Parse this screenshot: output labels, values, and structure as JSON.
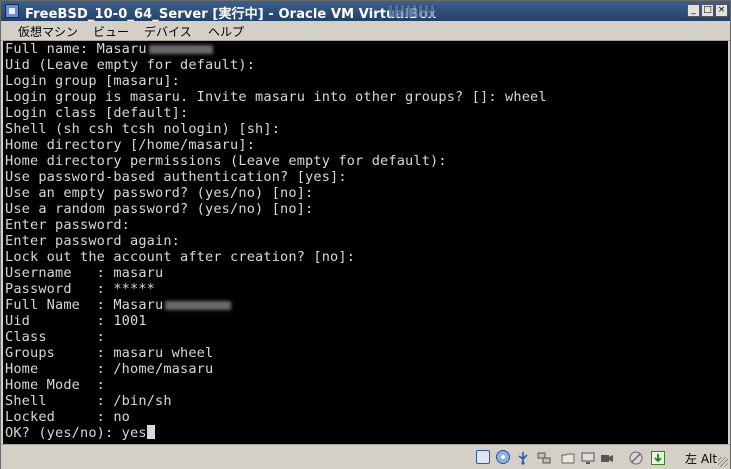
{
  "window": {
    "title": "FreeBSD_10-0_64_Server [実行中] - Oracle VM VirtualBox"
  },
  "menu": [
    "仮想マシン",
    "ビュー",
    "デバイス",
    "ヘルプ"
  ],
  "terminal": {
    "lines": [
      "Full name: Masaru",
      "Uid (Leave empty for default):",
      "Login group [masaru]:",
      "Login group is masaru. Invite masaru into other groups? []: wheel",
      "Login class [default]:",
      "Shell (sh csh tcsh nologin) [sh]:",
      "Home directory [/home/masaru]:",
      "Home directory permissions (Leave empty for default):",
      "Use password-based authentication? [yes]:",
      "Use an empty password? (yes/no) [no]:",
      "Use a random password? (yes/no) [no]:",
      "Enter password:",
      "Enter password again:",
      "Lock out the account after creation? [no]:",
      "Username   : masaru",
      "Password   : *****",
      "Full Name  : Masaru",
      "Uid        : 1001",
      "Class      :",
      "Groups     : masaru wheel",
      "Home       : /home/masaru",
      "Home Mode  :",
      "Shell      : /bin/sh",
      "Locked     : no",
      "OK? (yes/no): yes"
    ],
    "foreground_color": "#d8d8d8",
    "background_color": "#000000"
  },
  "status": {
    "host_key_label": "左 Alt",
    "icons": [
      "hard-disk-icon",
      "optical-drive-icon",
      "usb-icon",
      "network-icon",
      "shared-folders-icon",
      "display-icon",
      "video-capture-icon",
      "mouse-integration-icon",
      "host-key-arrow-icon"
    ]
  }
}
